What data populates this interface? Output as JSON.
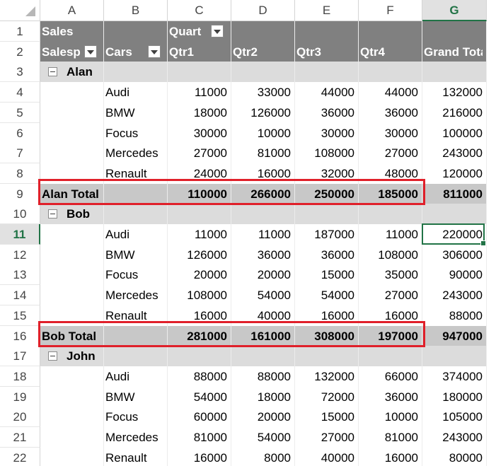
{
  "columns": [
    "A",
    "B",
    "C",
    "D",
    "E",
    "F",
    "G"
  ],
  "selected_column": "G",
  "selected_row": "11",
  "rows": [
    {
      "n": "1",
      "kind": "header1",
      "a": "Sales",
      "c": "Quart"
    },
    {
      "n": "2",
      "kind": "header2",
      "a": "Salesp",
      "b": "Cars",
      "c": "Qtr1",
      "d": "Qtr2",
      "e": "Qtr3",
      "f": "Qtr4",
      "g": "Grand Tota"
    },
    {
      "n": "3",
      "kind": "group",
      "a": "Alan"
    },
    {
      "n": "4",
      "kind": "item",
      "b": "Audi",
      "c": "11000",
      "d": "33000",
      "e": "44000",
      "f": "44000",
      "g": "132000"
    },
    {
      "n": "5",
      "kind": "item",
      "b": "BMW",
      "c": "18000",
      "d": "126000",
      "e": "36000",
      "f": "36000",
      "g": "216000"
    },
    {
      "n": "6",
      "kind": "item",
      "b": "Focus",
      "c": "30000",
      "d": "10000",
      "e": "30000",
      "f": "30000",
      "g": "100000"
    },
    {
      "n": "7",
      "kind": "item",
      "b": "Mercedes",
      "c": "27000",
      "d": "81000",
      "e": "108000",
      "f": "27000",
      "g": "243000"
    },
    {
      "n": "8",
      "kind": "item",
      "b": "Renault",
      "c": "24000",
      "d": "16000",
      "e": "32000",
      "f": "48000",
      "g": "120000"
    },
    {
      "n": "9",
      "kind": "total",
      "a": "Alan Total",
      "c": "110000",
      "d": "266000",
      "e": "250000",
      "f": "185000",
      "g": "811000"
    },
    {
      "n": "10",
      "kind": "group",
      "a": "Bob"
    },
    {
      "n": "11",
      "kind": "item",
      "b": "Audi",
      "c": "11000",
      "d": "11000",
      "e": "187000",
      "f": "11000",
      "g": "220000"
    },
    {
      "n": "12",
      "kind": "item",
      "b": "BMW",
      "c": "126000",
      "d": "36000",
      "e": "36000",
      "f": "108000",
      "g": "306000"
    },
    {
      "n": "13",
      "kind": "item",
      "b": "Focus",
      "c": "20000",
      "d": "20000",
      "e": "15000",
      "f": "35000",
      "g": "90000"
    },
    {
      "n": "14",
      "kind": "item",
      "b": "Mercedes",
      "c": "108000",
      "d": "54000",
      "e": "54000",
      "f": "27000",
      "g": "243000"
    },
    {
      "n": "15",
      "kind": "item",
      "b": "Renault",
      "c": "16000",
      "d": "40000",
      "e": "16000",
      "f": "16000",
      "g": "88000"
    },
    {
      "n": "16",
      "kind": "total",
      "a": "Bob Total",
      "c": "281000",
      "d": "161000",
      "e": "308000",
      "f": "197000",
      "g": "947000"
    },
    {
      "n": "17",
      "kind": "group",
      "a": "John"
    },
    {
      "n": "18",
      "kind": "item",
      "b": "Audi",
      "c": "88000",
      "d": "88000",
      "e": "132000",
      "f": "66000",
      "g": "374000"
    },
    {
      "n": "19",
      "kind": "item",
      "b": "BMW",
      "c": "54000",
      "d": "18000",
      "e": "72000",
      "f": "36000",
      "g": "180000"
    },
    {
      "n": "20",
      "kind": "item",
      "b": "Focus",
      "c": "60000",
      "d": "20000",
      "e": "15000",
      "f": "10000",
      "g": "105000"
    },
    {
      "n": "21",
      "kind": "item",
      "b": "Mercedes",
      "c": "81000",
      "d": "54000",
      "e": "27000",
      "f": "81000",
      "g": "243000"
    },
    {
      "n": "22",
      "kind": "item",
      "b": "Renault",
      "c": "16000",
      "d": "8000",
      "e": "40000",
      "f": "16000",
      "g": "80000"
    }
  ],
  "colors": {
    "header_band": "#808080",
    "group_band": "#dcdcdc",
    "total_band": "#c8c8c8",
    "highlight": "#e0202a",
    "excel_green": "#217346"
  },
  "icons": {
    "filter": "filter-dropdown-icon",
    "collapse": "collapse-minus-icon",
    "select_all": "select-all-triangle-icon"
  }
}
